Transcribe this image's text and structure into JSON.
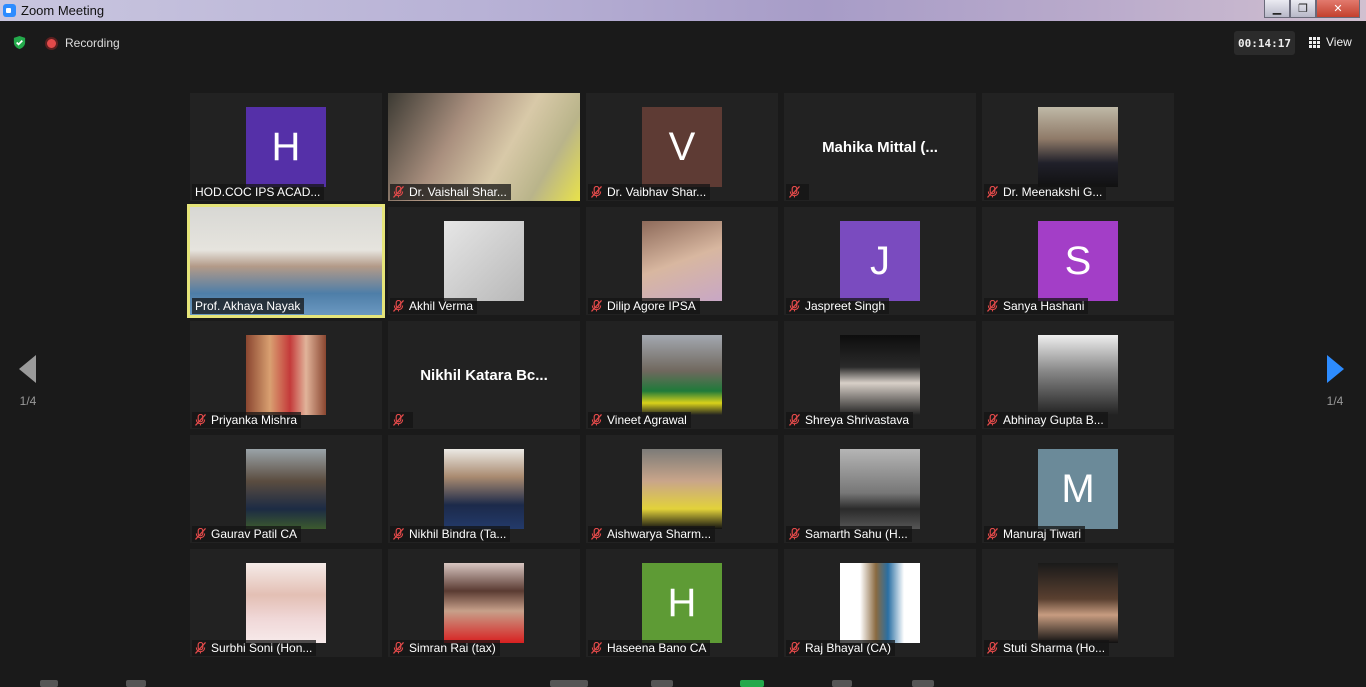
{
  "window": {
    "title": "Zoom Meeting",
    "minimize_label": "▁",
    "restore_label": "❐",
    "close_label": "✕"
  },
  "topbar": {
    "recording_label": "Recording",
    "timer": "00:14:17",
    "view_label": "View"
  },
  "pagination": {
    "left_label": "1/4",
    "right_label": "1/4"
  },
  "colors": {
    "accent": "#2d8cff",
    "active_speaker": "#e6e57a",
    "mute": "#e24a4a",
    "tile_bg": "#222222"
  },
  "participants": [
    {
      "name": "HOD.COC IPS ACAD...",
      "initial": "H",
      "color": "#5530a8",
      "kind": "avatar",
      "muted": false
    },
    {
      "name": "Dr. Vaishali Shar...",
      "kind": "video",
      "muted": true
    },
    {
      "name": "Dr. Vaibhav Shar...",
      "initial": "V",
      "color": "#5e3b34",
      "kind": "avatar",
      "muted": true
    },
    {
      "name": "",
      "display_name": "Mahika  Mittal  (...",
      "kind": "text",
      "muted": true
    },
    {
      "name": "Dr. Meenakshi G...",
      "kind": "photo",
      "muted": true
    },
    {
      "name": "Prof. Akhaya Nayak",
      "kind": "video",
      "muted": false,
      "active": true
    },
    {
      "name": "Akhil Verma",
      "kind": "photo",
      "muted": true
    },
    {
      "name": "Dilip Agore IPSA",
      "kind": "photo",
      "muted": true
    },
    {
      "name": "Jaspreet Singh",
      "initial": "J",
      "color": "#7a4bbf",
      "kind": "avatar",
      "muted": true
    },
    {
      "name": "Sanya Hashani",
      "initial": "S",
      "color": "#a33ec7",
      "kind": "avatar",
      "muted": true
    },
    {
      "name": "Priyanka Mishra",
      "kind": "photo",
      "muted": true
    },
    {
      "name": "",
      "display_name": "Nikhil  Katara  Bc...",
      "kind": "text",
      "muted": true
    },
    {
      "name": "Vineet Agrawal",
      "kind": "photo",
      "muted": true
    },
    {
      "name": "Shreya Shrivastava",
      "kind": "photo",
      "muted": true
    },
    {
      "name": "Abhinay Gupta B...",
      "kind": "photo",
      "muted": true
    },
    {
      "name": "Gaurav Patil CA",
      "kind": "photo",
      "muted": true
    },
    {
      "name": "Nikhil Bindra (Ta...",
      "kind": "photo",
      "muted": true
    },
    {
      "name": "Aishwarya Sharm...",
      "kind": "photo",
      "muted": true
    },
    {
      "name": "Samarth Sahu (H...",
      "kind": "photo",
      "muted": true
    },
    {
      "name": "Manuraj Tiwari",
      "initial": "M",
      "color": "#6b8a99",
      "kind": "avatar",
      "muted": true
    },
    {
      "name": "Surbhi Soni (Hon...",
      "kind": "photo",
      "muted": true
    },
    {
      "name": "Simran Rai (tax)",
      "kind": "photo",
      "muted": true
    },
    {
      "name": "Haseena Bano CA",
      "initial": "H",
      "color": "#5e9b35",
      "kind": "avatar",
      "muted": true
    },
    {
      "name": "Raj Bhayal (CA)",
      "kind": "photo",
      "muted": true
    },
    {
      "name": "Stuti Sharma (Ho...",
      "kind": "photo",
      "muted": true
    }
  ]
}
